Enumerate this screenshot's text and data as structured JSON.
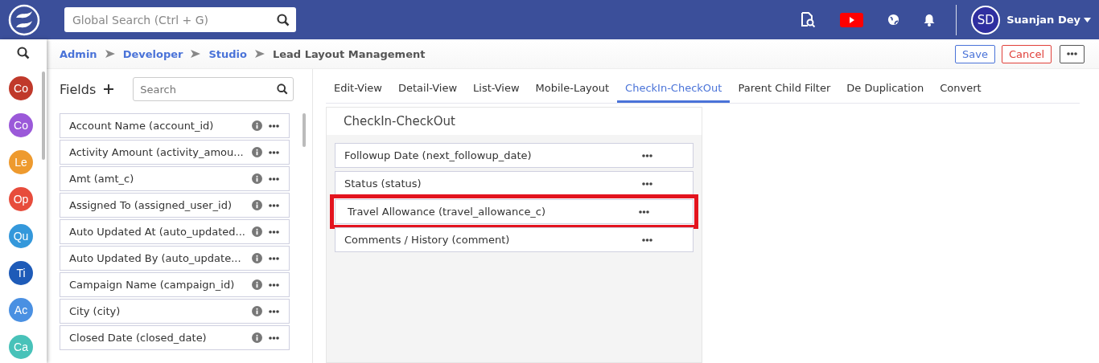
{
  "topbar": {
    "search": {
      "placeholder": "Global Search (Ctrl + G)"
    },
    "user": {
      "initials": "SD",
      "name": "Suanjan Dey"
    }
  },
  "sidebar": {
    "modules": [
      {
        "label": "Co",
        "color": "#c0392b"
      },
      {
        "label": "Co",
        "color": "#9b59d9"
      },
      {
        "label": "Le",
        "color": "#ee9a2e"
      },
      {
        "label": "Op",
        "color": "#e74c3c"
      },
      {
        "label": "Qu",
        "color": "#3498db"
      },
      {
        "label": "Ti",
        "color": "#1e5bb8"
      },
      {
        "label": "Ac",
        "color": "#4a90e2"
      },
      {
        "label": "Ca",
        "color": "#48c2b9"
      }
    ]
  },
  "breadcrumb": [
    {
      "label": "Admin",
      "link": true
    },
    {
      "label": "Developer",
      "link": true
    },
    {
      "label": "Studio",
      "link": true
    },
    {
      "label": "Lead Layout Management",
      "link": false
    }
  ],
  "actions": {
    "save": "Save",
    "cancel": "Cancel"
  },
  "fields_panel": {
    "title": "Fields",
    "search": {
      "placeholder": "Search"
    },
    "fields": [
      "Account Name (account_id)",
      "Activity Amount (activity_amou...",
      "Amt (amt_c)",
      "Assigned To (assigned_user_id)",
      "Auto Updated At (auto_updated...",
      "Auto Updated By (auto_update...",
      "Campaign Name (campaign_id)",
      "City (city)",
      "Closed Date (closed_date)"
    ]
  },
  "tabs": [
    {
      "label": "Edit-View",
      "selected": false
    },
    {
      "label": "Detail-View",
      "selected": false
    },
    {
      "label": "List-View",
      "selected": false
    },
    {
      "label": "Mobile-Layout",
      "selected": false
    },
    {
      "label": "CheckIn-CheckOut",
      "selected": true
    },
    {
      "label": "Parent Child Filter",
      "selected": false
    },
    {
      "label": "De Duplication",
      "selected": false
    },
    {
      "label": "Convert",
      "selected": false
    }
  ],
  "layout_panel": {
    "title": "CheckIn-CheckOut",
    "rows": [
      {
        "label": "Followup Date (next_followup_date)",
        "highlighted": false
      },
      {
        "label": "Status (status)",
        "highlighted": false
      },
      {
        "label": "Travel Allowance (travel_allowance_c)",
        "highlighted": true
      },
      {
        "label": "Comments / History (comment)",
        "highlighted": false
      }
    ]
  }
}
